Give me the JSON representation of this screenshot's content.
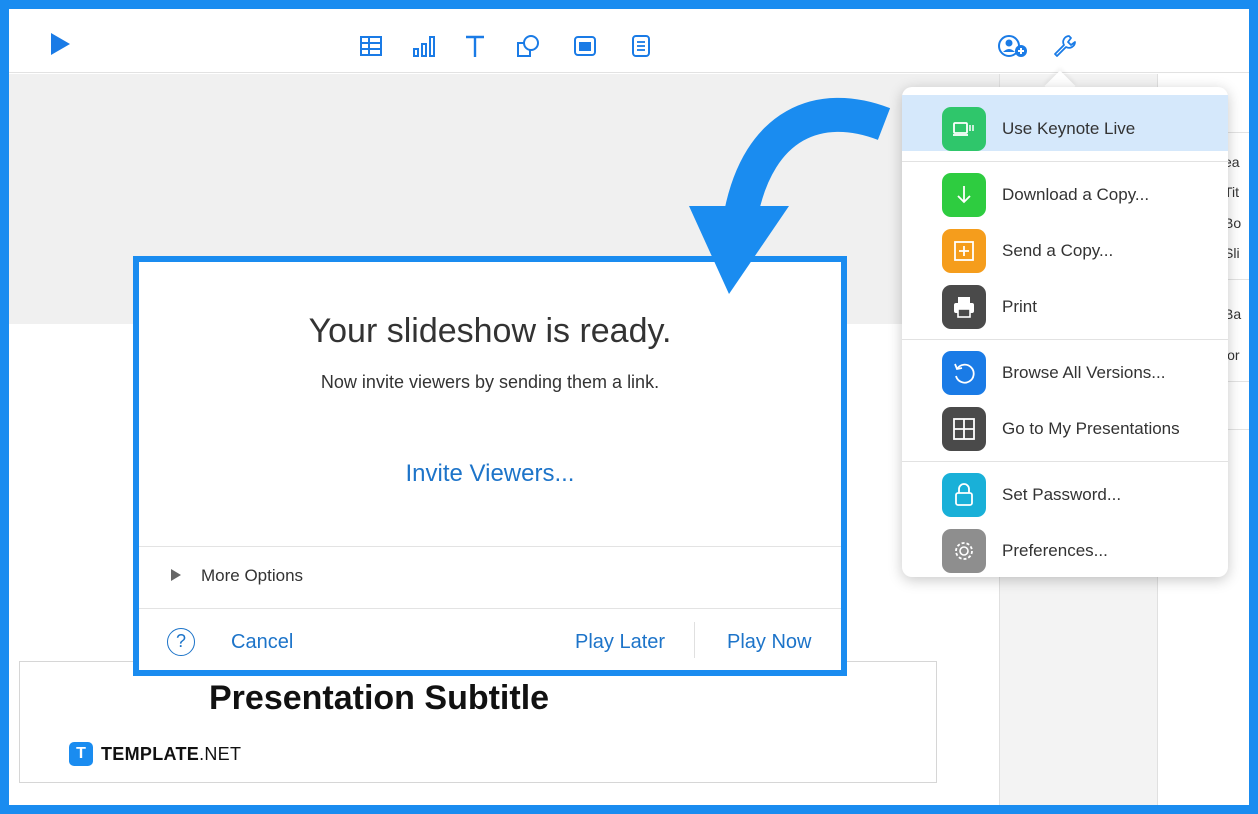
{
  "toolbar": {
    "play": "play-icon",
    "tools": [
      "table-icon",
      "chart-icon",
      "text-icon",
      "shape-icon",
      "media-icon",
      "comment-icon"
    ],
    "right": [
      "collaborate-icon",
      "wrench-icon"
    ]
  },
  "dialog": {
    "title": "Your slideshow is ready.",
    "subtitle": "Now invite viewers by sending them a link.",
    "invite_link": "Invite Viewers...",
    "more_options": "More Options",
    "help": "?",
    "cancel": "Cancel",
    "play_later": "Play Later",
    "play_now": "Play Now"
  },
  "slide": {
    "subtitle": "Presentation Subtitle"
  },
  "brand": {
    "logo_letter": "T",
    "name_bold": "TEMPLATE",
    "name_rest": ".NET"
  },
  "menu": {
    "items": [
      {
        "label": "Use Keynote Live",
        "icon": "keynote-live-icon",
        "color": "#2fc66b"
      },
      {
        "label": "Download a Copy...",
        "icon": "download-icon",
        "color": "#2ecc40"
      },
      {
        "label": "Send a Copy...",
        "icon": "send-copy-icon",
        "color": "#f59d1c"
      },
      {
        "label": "Print",
        "icon": "print-icon",
        "color": "#4a4a4a"
      },
      {
        "label": "Browse All Versions...",
        "icon": "versions-icon",
        "color": "#1a7be6"
      },
      {
        "label": "Go to My Presentations",
        "icon": "presentations-icon",
        "color": "#4a4a4a"
      },
      {
        "label": "Set Password...",
        "icon": "lock-icon",
        "color": "#19b0d8"
      },
      {
        "label": "Preferences...",
        "icon": "gear-icon",
        "color": "#8e8e8e"
      }
    ]
  },
  "inspector": {
    "fragments": [
      "ea",
      "Tit",
      "Bo",
      "Sli",
      "Ba",
      "lor"
    ]
  },
  "colors": {
    "accent": "#1a8cf0",
    "link": "#1d74c9",
    "highlight": "#d5e8fb"
  }
}
